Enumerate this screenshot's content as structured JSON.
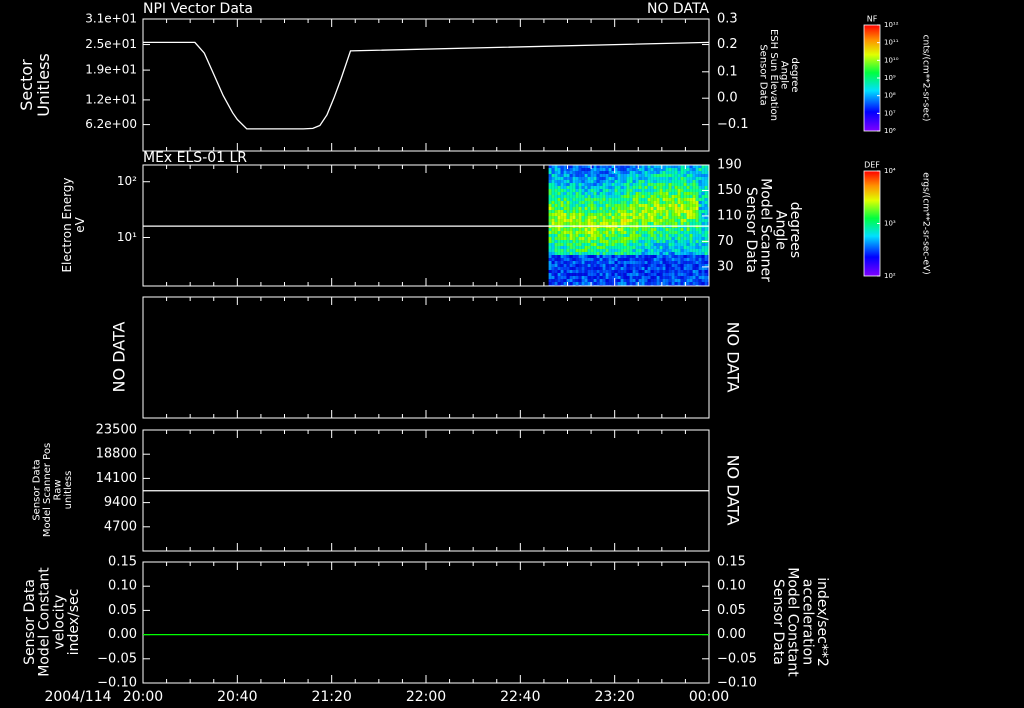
{
  "colors": {
    "background": "#000000",
    "foreground": "#ffffff",
    "green": "#00ff00"
  },
  "x_axis": {
    "date_label": "2004/114",
    "ticks": [
      {
        "t": 0,
        "label": "20:00"
      },
      {
        "t": 40,
        "label": "20:40"
      },
      {
        "t": 80,
        "label": "21:20"
      },
      {
        "t": 120,
        "label": "22:00"
      },
      {
        "t": 160,
        "label": "22:40"
      },
      {
        "t": 200,
        "label": "23:20"
      },
      {
        "t": 240,
        "label": "00:00"
      }
    ],
    "range": [
      0,
      240
    ],
    "minor_step": 10
  },
  "chart_data": [
    {
      "type": "line",
      "title": "NPI Vector Data",
      "status_right": "NO DATA",
      "ylabel": [
        "Sector",
        "Unitless"
      ],
      "ylim": [
        0,
        31
      ],
      "yticks": [
        {
          "v": 31,
          "label": "3.1e+01"
        },
        {
          "v": 25,
          "label": "2.5e+01"
        },
        {
          "v": 19,
          "label": "1.9e+01"
        },
        {
          "v": 12,
          "label": "1.2e+01"
        },
        {
          "v": 6.2,
          "label": "6.2e+00"
        }
      ],
      "ylabel_right": [
        "Sensor Data",
        "ESH Sun Elevation",
        "Angle",
        "degree"
      ],
      "yticks_right": [
        {
          "v": 31,
          "label": "0.3"
        },
        {
          "v": 25,
          "label": "0.2"
        },
        {
          "v": 18.6,
          "label": "0.1"
        },
        {
          "v": 12.4,
          "label": "0.0"
        },
        {
          "v": 6.2,
          "label": "−0.1"
        }
      ],
      "series": [
        {
          "x": [
            0,
            22,
            26,
            30,
            34,
            38,
            40,
            44,
            60,
            68,
            72,
            75,
            78,
            81,
            84,
            88,
            240
          ],
          "y": [
            25.5,
            25.5,
            23,
            18,
            13,
            9,
            7.4,
            5.2,
            5.2,
            5.2,
            5.3,
            6,
            8.5,
            12.5,
            17,
            23.5,
            25.5
          ]
        }
      ],
      "colorbar": {
        "title": "NF",
        "label": "cnts/(cm**2-sr-sec)",
        "ticks": [
          "10¹²",
          "10¹¹",
          "10¹⁰",
          "10⁹",
          "10⁸",
          "10⁷",
          "10⁶"
        ]
      }
    },
    {
      "type": "heatmap",
      "title": "MEx ELS-01 LR",
      "ylabel": [
        "Electron Energy",
        "eV"
      ],
      "ylim_log": [
        0.13,
        2.3
      ],
      "yticks": [
        {
          "v": 2,
          "label": "10²"
        },
        {
          "v": 1,
          "label": "10¹"
        }
      ],
      "ylabel_right": [
        "Sensor Data",
        "Model Scanner",
        "Angle",
        "degrees"
      ],
      "yticks_right_range": [
        0,
        190
      ],
      "yticks_right": [
        {
          "v": 190,
          "label": "190"
        },
        {
          "v": 150,
          "label": "150"
        },
        {
          "v": 110,
          "label": "110"
        },
        {
          "v": 70,
          "label": "70"
        },
        {
          "v": 30,
          "label": "30"
        }
      ],
      "data_start": 172,
      "data_end": 240,
      "line_angle": 94,
      "colorbar": {
        "title": "DEF",
        "label": "ergs/(cm**2-sr-sec-eV)",
        "ticks": [
          "10⁴",
          "10³",
          "10²"
        ]
      }
    },
    {
      "type": "line",
      "status_left": "NO DATA",
      "status_right": "NO DATA"
    },
    {
      "type": "line",
      "ylabel": [
        "Sensor Data",
        "Model Scanner Pos",
        "Raw",
        "unitless"
      ],
      "ylim": [
        0,
        23500
      ],
      "yticks": [
        {
          "v": 23500,
          "label": "23500"
        },
        {
          "v": 18800,
          "label": "18800"
        },
        {
          "v": 14100,
          "label": "14100"
        },
        {
          "v": 9400,
          "label": "9400"
        },
        {
          "v": 4700,
          "label": "4700"
        }
      ],
      "status_right": "NO DATA",
      "series": [
        {
          "x": [
            0,
            240
          ],
          "y": [
            11700,
            11700
          ]
        }
      ]
    },
    {
      "type": "line",
      "ylabel": [
        "Sensor Data",
        "Model Constant",
        "velocity",
        "index/sec"
      ],
      "ylim": [
        -0.1,
        0.15
      ],
      "yticks": [
        {
          "v": 0.15,
          "label": "0.15"
        },
        {
          "v": 0.1,
          "label": "0.10"
        },
        {
          "v": 0.05,
          "label": "0.05"
        },
        {
          "v": 0,
          "label": "0.00"
        },
        {
          "v": -0.05,
          "label": "−0.05"
        },
        {
          "v": -0.1,
          "label": "−0.10"
        }
      ],
      "ylabel_right": [
        "Sensor Data",
        "Model Constant",
        "acceleration",
        "index/sec**2"
      ],
      "series": [
        {
          "x": [
            0,
            240
          ],
          "y": [
            0,
            0
          ]
        }
      ]
    }
  ]
}
